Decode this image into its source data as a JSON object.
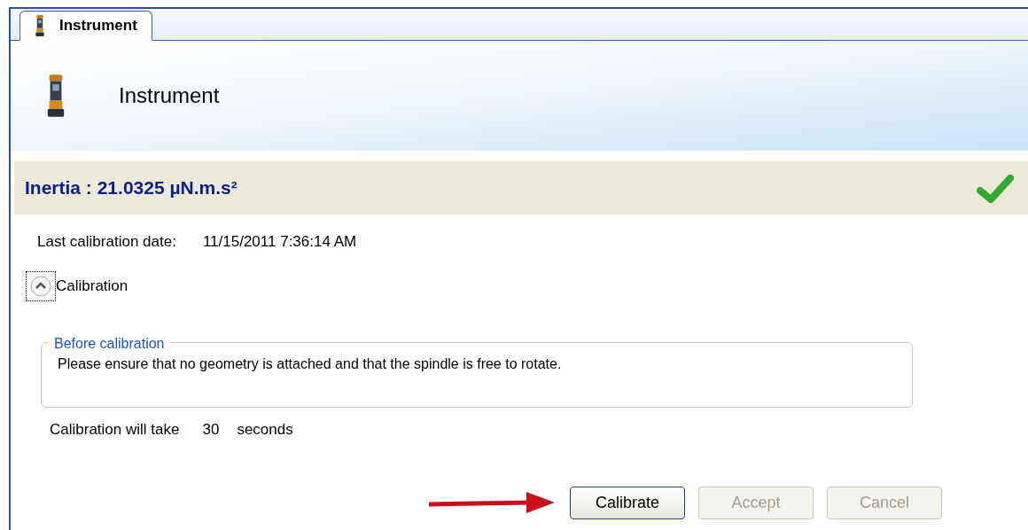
{
  "tabs": [
    {
      "label": "Instrument",
      "selected": true
    }
  ],
  "header": {
    "title": "Instrument"
  },
  "result": {
    "text": "Inertia : 21.0325 µN.m.s²",
    "ok": true
  },
  "last_calibration": {
    "label": "Last calibration date:",
    "value": "11/15/2011 7:36:14 AM"
  },
  "calibration_section": {
    "label": "Calibration",
    "expanded": true
  },
  "before_calibration": {
    "title": "Before calibration",
    "text": "Please ensure that no geometry is attached and that the spindle is free to rotate."
  },
  "duration": {
    "label": "Calibration will take",
    "value": "30",
    "unit": "seconds"
  },
  "buttons": [
    {
      "label": "Calibrate",
      "disabled": false
    },
    {
      "label": "Accept",
      "disabled": true
    },
    {
      "label": "Cancel",
      "disabled": true
    }
  ]
}
